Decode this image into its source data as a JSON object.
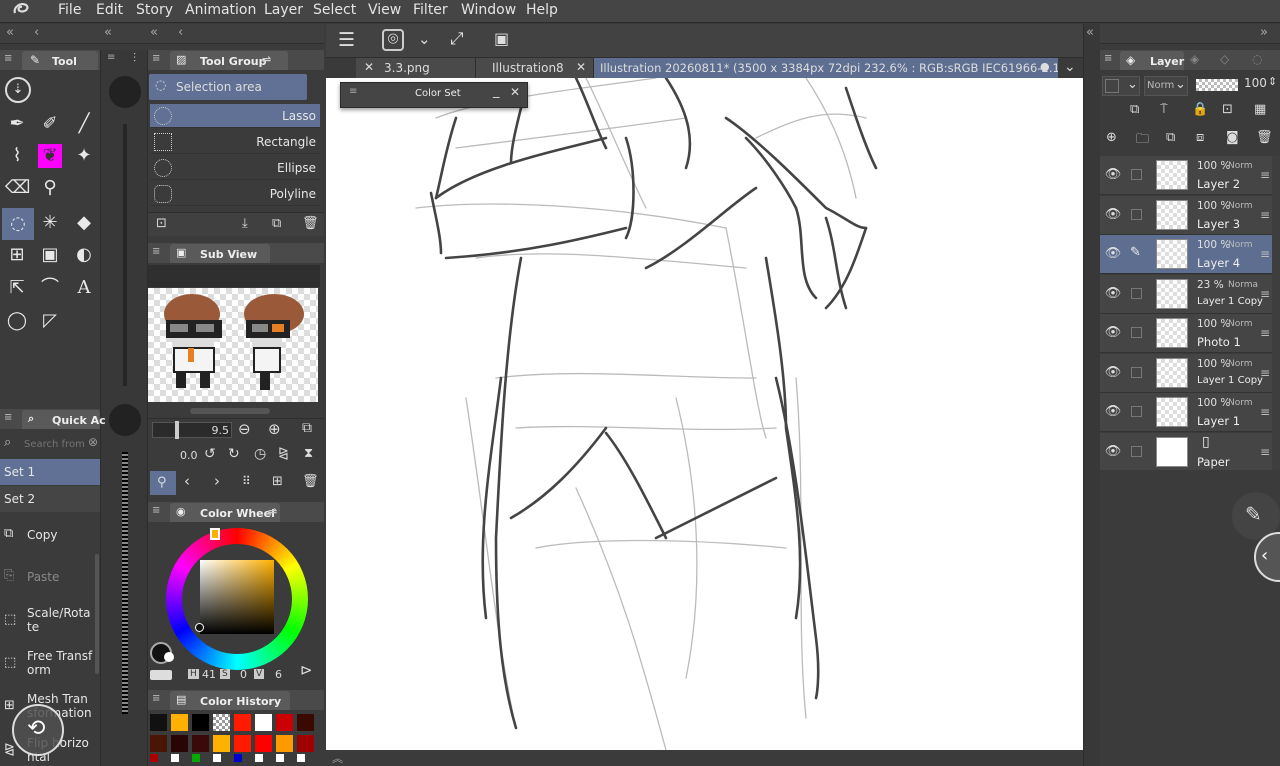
{
  "menu": {
    "items": [
      "File",
      "Edit",
      "Story",
      "Animation",
      "Layer",
      "Select",
      "View",
      "Filter",
      "Window",
      "Help"
    ]
  },
  "tool_panel": {
    "title": "Tool"
  },
  "tool_group": {
    "title": "Tool Group",
    "header_item": "Selection area",
    "items": [
      "Lasso",
      "Rectangle",
      "Ellipse",
      "Polyline"
    ],
    "selected": "Lasso"
  },
  "sub_view": {
    "title": "Sub View"
  },
  "brush_size": {
    "value": "9.5",
    "rotation": "0.0"
  },
  "quick_access": {
    "title": "Quick Ac",
    "search_placeholder": "Search from",
    "sets": [
      "Set 1",
      "Set 2"
    ],
    "commands": [
      "Copy",
      "Paste",
      "Scale/Rotate",
      "Free Transform",
      "Mesh Transformation",
      "Flip horizontal"
    ]
  },
  "color_wheel": {
    "title": "Color Wheel",
    "h_label": "H",
    "h": "41",
    "s_label": "S",
    "s": "0",
    "v_label": "V",
    "v": "6"
  },
  "color_history": {
    "title": "Color History",
    "colors_row1": [
      "#111111",
      "#ffb000",
      "#000000",
      "checker",
      "#ff1a00",
      "#ffffff",
      "#cc0000",
      "#3a0a00"
    ],
    "colors_row2": [
      "#4a1505",
      "#2a0505",
      "#3a0a0a",
      "#ffb000",
      "#ff1a00",
      "#ff0000",
      "#ff9900",
      "#a00000"
    ],
    "colors_row3": [
      "#aa0000",
      "#ffffff",
      "#00aa00",
      "#ffffff",
      "#0000cc",
      "#ffffff",
      "#ffffff",
      "#ffffff"
    ]
  },
  "doc_tabs": {
    "tabs": [
      "3.3.png",
      "Illustration8",
      "Illustration 20260811* (3500 x 3384px 72dpi 232.6% : RGB:sRGB IEC61966-2.1)"
    ],
    "active": 2
  },
  "color_set": {
    "title": "Color Set"
  },
  "layer_panel": {
    "title": "Layer",
    "blend_mode": "Norm",
    "opacity": "100",
    "layers": [
      {
        "opacity": "100 %",
        "mode": "Norm",
        "name": "Layer 2"
      },
      {
        "opacity": "100 %",
        "mode": "Norm",
        "name": "Layer 3"
      },
      {
        "opacity": "100 %",
        "mode": "Norm",
        "name": "Layer 4"
      },
      {
        "opacity": "23 %",
        "mode": "Norma",
        "name": "Layer 1 Copy"
      },
      {
        "opacity": "100 %",
        "mode": "Norm",
        "name": "Photo 1"
      },
      {
        "opacity": "100 %",
        "mode": "Norm",
        "name": "Layer 1 Copy"
      },
      {
        "opacity": "100 %",
        "mode": "Norm",
        "name": "Layer 1"
      },
      {
        "opacity": "",
        "mode": "",
        "name": "Paper"
      }
    ],
    "active_index": 2
  },
  "colors": {
    "accent": "#607195",
    "panel_bg": "#3b3b3b",
    "highlight_tool": "#ff00ff"
  },
  "icons": {
    "canvas_toolbar": [
      "hamburger-icon",
      "lasso-logo-icon",
      "chevron-down-icon",
      "expand-icon",
      "layer-save-icon"
    ]
  }
}
